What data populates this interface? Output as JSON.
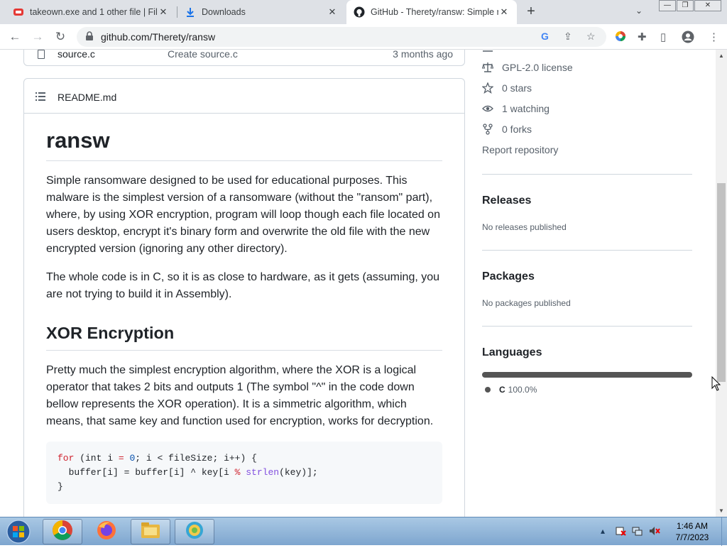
{
  "browser": {
    "tabs": [
      {
        "title": "takeown.exe and 1 other file | File",
        "icon": "file-share-favicon"
      },
      {
        "title": "Downloads",
        "icon": "download-icon"
      },
      {
        "title": "GitHub - Therety/ransw: Simple r",
        "icon": "github-favicon",
        "active": true
      }
    ],
    "new_tab_label": "+",
    "url": "github.com/Therety/ransw"
  },
  "file_row": {
    "name": "source.c",
    "commit_message": "Create source.c",
    "age": "3 months ago"
  },
  "readme": {
    "filename": "README.md",
    "title": "ransw",
    "paragraph1": "Simple ransomware designed to be used for educational purposes. This malware is the simplest version of a ransomware (without the \"ransom\" part), where, by using XOR encryption, program will loop though each file located on users desktop, encrypt it's binary form and overwrite the old file with the new encrypted version (ignoring any other directory).",
    "paragraph2": "The whole code is in C, so it is as close to hardware, as it gets (assuming, you are not trying to build it in Assembly).",
    "section_heading": "XOR Encryption",
    "paragraph3": "Pretty much the simplest encryption algorithm, where the XOR is a logical operator that takes 2 bits and outputs 1 (The symbol \"^\" in the code down bellow represents the XOR operation). It is a simmetric algorithm, which means, that same key and function used for encryption, works for decryption.",
    "code": {
      "kw_for": "for",
      "head_open": " (int i ",
      "eq": "=",
      "zero": " 0",
      "head_rest": "; i < fileSize; i++) {",
      "line2_a": "  buffer[i] = buffer[i] ^ key[i ",
      "mod": "%",
      "fn_strlen": " strlen",
      "line2_b": "(key)];",
      "line3": "}"
    }
  },
  "sidebar": {
    "license": "GPL-2.0 license",
    "stars": "0 stars",
    "watching": "1 watching",
    "forks": "0 forks",
    "report": "Report repository",
    "releases_heading": "Releases",
    "releases_text": "No releases published",
    "packages_heading": "Packages",
    "packages_text": "No packages published",
    "languages_heading": "Languages",
    "language_name": "C",
    "language_percent": "100.0%",
    "language_share": 1.0,
    "language_color": "#555555"
  },
  "taskbar": {
    "apps": [
      "chrome-icon",
      "firefox-icon",
      "file-explorer-icon",
      "settings-app-icon"
    ],
    "time": "1:46 AM",
    "date": "7/7/2023"
  }
}
